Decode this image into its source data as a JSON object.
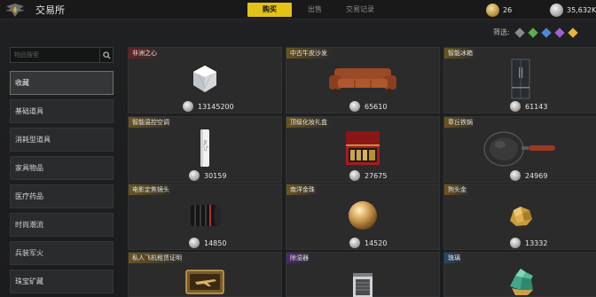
{
  "header": {
    "title": "交易所",
    "tabs": [
      {
        "label": "购买",
        "active": true
      },
      {
        "label": "出售",
        "active": false
      },
      {
        "label": "交易记录",
        "active": false
      }
    ],
    "gold_amount": "26",
    "silver_amount": "35,632K"
  },
  "filter": {
    "label": "筛选:",
    "colors": [
      "#8a8a8a",
      "#5fae4c",
      "#4f88d6",
      "#a060d0",
      "#e0b63a"
    ]
  },
  "sidebar": {
    "search_placeholder": "物品搜索",
    "items": [
      {
        "label": "收藏",
        "active": true
      },
      {
        "label": "基础道具",
        "active": false
      },
      {
        "label": "消耗型道具",
        "active": false
      },
      {
        "label": "家具物品",
        "active": false
      },
      {
        "label": "医疗药品",
        "active": false
      },
      {
        "label": "时尚潮流",
        "active": false
      },
      {
        "label": "兵装军火",
        "active": false
      },
      {
        "label": "珠宝矿藏",
        "active": false
      }
    ]
  },
  "items": [
    {
      "name": "非洲之心",
      "rarity": "red",
      "price": "13145200",
      "icon": "diamond-icon"
    },
    {
      "name": "中古牛皮沙发",
      "rarity": "gold",
      "price": "65610",
      "icon": "sofa-icon"
    },
    {
      "name": "智能冰箱",
      "rarity": "gold",
      "price": "61143",
      "icon": "fridge-icon"
    },
    {
      "name": "智能温控空调",
      "rarity": "gold",
      "price": "30159",
      "icon": "air-conditioner-icon"
    },
    {
      "name": "顶级化妆礼盒",
      "rarity": "gold",
      "price": "27675",
      "icon": "makeup-box-icon"
    },
    {
      "name": "章丘铁锅",
      "rarity": "gold",
      "price": "24969",
      "icon": "wok-icon"
    },
    {
      "name": "电影定焦镜头",
      "rarity": "gold",
      "price": "14850",
      "icon": "lens-icon"
    },
    {
      "name": "南洋金珠",
      "rarity": "gold",
      "price": "14520",
      "icon": "pearl-icon"
    },
    {
      "name": "狗头金",
      "rarity": "gold",
      "price": "13332",
      "icon": "gold-nugget-icon"
    },
    {
      "name": "私人飞机租赁证明",
      "rarity": "gold",
      "price": "",
      "icon": "jet-certificate-icon"
    },
    {
      "name": "除湿器",
      "rarity": "purple",
      "price": "",
      "icon": "dehumidifier-icon"
    },
    {
      "name": "琉璃",
      "rarity": "blue",
      "price": "",
      "icon": "glaze-crystal-icon"
    }
  ]
}
